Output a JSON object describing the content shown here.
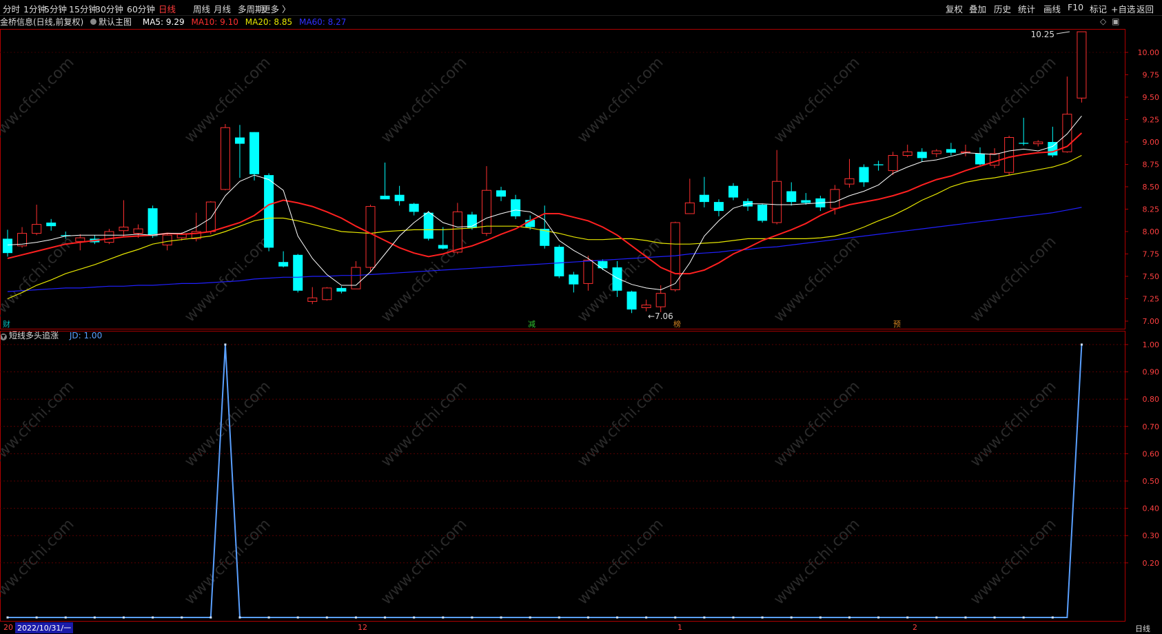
{
  "toolbar": {
    "left_tabs": [
      "分时",
      "1分钟",
      "5分钟",
      "15分钟",
      "30分钟",
      "60分钟",
      "日线",
      "周线",
      "月线",
      "多周期",
      "更多 〉"
    ],
    "active_tab": "日线",
    "right_tabs": [
      "复权",
      "叠加",
      "历史",
      "统计",
      "画线",
      "F10",
      "标记",
      "+自选",
      "返回"
    ]
  },
  "info": {
    "stock": "金桥信息(日线,前复权)",
    "main_chart": "默认主图",
    "ma5": "MA5: 9.29",
    "ma10": "MA10: 9.10",
    "ma20": "MA20: 8.85",
    "ma60": "MA60: 8.27"
  },
  "indicator_info": {
    "name": "短线多头追涨",
    "jd": "JD: 1.00"
  },
  "colors": {
    "up": "#ff3030",
    "down": "#00ffff",
    "ma5": "#ffffff",
    "ma10": "#ff2020",
    "ma20": "#e6e600",
    "ma60": "#2020ff",
    "indicator": "#5aa0ff",
    "axis": "#b00000"
  },
  "price_axis": [
    "10.00",
    "9.75",
    "9.50",
    "9.25",
    "9.00",
    "8.75",
    "8.50",
    "8.25",
    "8.00",
    "7.75",
    "7.50",
    "7.25",
    "7.00"
  ],
  "indicator_axis": [
    "1.00",
    "0.90",
    "0.80",
    "0.70",
    "0.60",
    "0.50",
    "0.40",
    "0.30",
    "0.20"
  ],
  "annotations": {
    "high": "10.25",
    "low": "←7.06",
    "markers": [
      "财",
      "减",
      "榜",
      "预"
    ]
  },
  "date_axis": {
    "cursor_date": "2022/10/31/一",
    "left_stub": "20",
    "months": [
      "12",
      "1",
      "2"
    ]
  },
  "bottom_right": "日线",
  "watermark": "www.cfchi.com",
  "chart_data": {
    "type": "candlestick",
    "ylim": [
      7.0,
      10.3
    ],
    "candles": [
      [
        7.92,
        7.76,
        8.02,
        7.72
      ],
      [
        7.84,
        7.98,
        8.05,
        7.82
      ],
      [
        7.98,
        8.08,
        8.3,
        7.96
      ],
      [
        8.1,
        8.06,
        8.14,
        8.01
      ],
      [
        7.96,
        7.95,
        8.0,
        7.92
      ],
      [
        7.89,
        7.93,
        7.97,
        7.79
      ],
      [
        7.92,
        7.88,
        7.96,
        7.86
      ],
      [
        7.88,
        8.0,
        8.03,
        7.86
      ],
      [
        8.01,
        8.05,
        8.35,
        7.94
      ],
      [
        7.98,
        8.03,
        8.08,
        7.93
      ],
      [
        8.26,
        7.95,
        8.29,
        7.93
      ],
      [
        7.85,
        7.96,
        7.98,
        7.79
      ],
      [
        7.93,
        7.97,
        7.99,
        7.9
      ],
      [
        7.92,
        8.0,
        8.21,
        7.89
      ],
      [
        8.0,
        8.33,
        8.34,
        7.97
      ],
      [
        8.47,
        9.16,
        9.2,
        8.46
      ],
      [
        9.05,
        8.98,
        9.19,
        8.6
      ],
      [
        9.11,
        8.64,
        9.11,
        8.57
      ],
      [
        8.63,
        7.82,
        8.65,
        7.78
      ],
      [
        7.66,
        7.61,
        7.78,
        7.6
      ],
      [
        7.74,
        7.34,
        7.75,
        7.32
      ],
      [
        7.22,
        7.26,
        7.38,
        7.19
      ],
      [
        7.24,
        7.37,
        7.38,
        7.23
      ],
      [
        7.37,
        7.33,
        7.39,
        7.31
      ],
      [
        7.36,
        7.6,
        7.67,
        7.36
      ],
      [
        7.6,
        8.28,
        8.3,
        7.55
      ],
      [
        8.4,
        8.36,
        8.77,
        8.36
      ],
      [
        8.41,
        8.34,
        8.51,
        8.29
      ],
      [
        8.31,
        8.22,
        8.32,
        8.18
      ],
      [
        8.21,
        7.92,
        8.23,
        7.9
      ],
      [
        7.85,
        7.81,
        8.05,
        7.8
      ],
      [
        7.77,
        8.22,
        8.32,
        7.75
      ],
      [
        8.19,
        8.04,
        8.22,
        8.02
      ],
      [
        7.98,
        8.46,
        8.73,
        7.95
      ],
      [
        8.46,
        8.39,
        8.5,
        8.34
      ],
      [
        8.36,
        8.17,
        8.41,
        8.14
      ],
      [
        8.13,
        8.05,
        8.18,
        8.02
      ],
      [
        8.03,
        7.84,
        8.29,
        7.81
      ],
      [
        7.83,
        7.5,
        7.85,
        7.48
      ],
      [
        7.52,
        7.41,
        7.55,
        7.32
      ],
      [
        7.42,
        7.68,
        7.73,
        7.34
      ],
      [
        7.67,
        7.59,
        7.69,
        7.57
      ],
      [
        7.6,
        7.34,
        7.67,
        7.27
      ],
      [
        7.33,
        7.13,
        7.34,
        7.09
      ],
      [
        7.15,
        7.18,
        7.24,
        7.11
      ],
      [
        7.16,
        7.31,
        7.4,
        7.1
      ],
      [
        7.35,
        8.1,
        8.11,
        7.33
      ],
      [
        8.2,
        8.32,
        8.59,
        8.2
      ],
      [
        8.41,
        8.33,
        8.61,
        8.27
      ],
      [
        8.33,
        8.23,
        8.36,
        8.17
      ],
      [
        8.51,
        8.38,
        8.54,
        8.35
      ],
      [
        8.34,
        8.28,
        8.37,
        8.23
      ],
      [
        8.3,
        8.12,
        8.31,
        8.1
      ],
      [
        8.1,
        8.56,
        8.91,
        8.08
      ],
      [
        8.45,
        8.33,
        8.55,
        8.29
      ],
      [
        8.35,
        8.32,
        8.43,
        8.3
      ],
      [
        8.37,
        8.27,
        8.4,
        8.23
      ],
      [
        8.26,
        8.47,
        8.52,
        8.19
      ],
      [
        8.53,
        8.59,
        8.81,
        8.49
      ],
      [
        8.72,
        8.55,
        8.75,
        8.5
      ],
      [
        8.75,
        8.74,
        8.79,
        8.68
      ],
      [
        8.68,
        8.85,
        8.89,
        8.63
      ],
      [
        8.85,
        8.89,
        8.97,
        8.83
      ],
      [
        8.89,
        8.82,
        8.93,
        8.78
      ],
      [
        8.87,
        8.9,
        8.92,
        8.83
      ],
      [
        8.92,
        8.88,
        8.99,
        8.85
      ],
      [
        8.88,
        8.89,
        8.97,
        8.84
      ],
      [
        8.87,
        8.75,
        8.94,
        8.74
      ],
      [
        8.74,
        8.87,
        8.93,
        8.71
      ],
      [
        8.66,
        9.05,
        9.07,
        8.63
      ],
      [
        8.99,
        8.98,
        9.27,
        8.96
      ],
      [
        8.98,
        9.0,
        9.02,
        8.95
      ],
      [
        9.0,
        8.85,
        9.17,
        8.83
      ],
      [
        8.89,
        9.31,
        9.73,
        8.88
      ],
      [
        9.49,
        10.23,
        10.23,
        9.44
      ]
    ],
    "ma5": [
      7.85,
      7.86,
      7.88,
      7.91,
      7.95,
      7.96,
      7.96,
      7.96,
      7.96,
      7.97,
      7.96,
      7.98,
      7.98,
      8.05,
      8.15,
      8.4,
      8.56,
      8.63,
      8.58,
      8.46,
      7.95,
      7.7,
      7.52,
      7.4,
      7.4,
      7.55,
      7.75,
      7.95,
      8.1,
      8.22,
      8.1,
      8.05,
      8.06,
      8.15,
      8.2,
      8.24,
      8.22,
      8.13,
      7.9,
      7.79,
      7.7,
      7.58,
      7.48,
      7.41,
      7.37,
      7.35,
      7.42,
      7.65,
      7.95,
      8.12,
      8.26,
      8.31,
      8.31,
      8.3,
      8.3,
      8.31,
      8.32,
      8.33,
      8.4,
      8.45,
      8.52,
      8.65,
      8.72,
      8.78,
      8.8,
      8.84,
      8.88,
      8.87,
      8.86,
      8.9,
      8.92,
      8.9,
      8.95,
      9.09,
      9.29
    ],
    "ma10": [
      7.7,
      7.74,
      7.78,
      7.82,
      7.86,
      7.88,
      7.9,
      7.92,
      7.94,
      7.95,
      7.96,
      7.98,
      7.97,
      7.98,
      8.0,
      8.05,
      8.1,
      8.18,
      8.3,
      8.35,
      8.32,
      8.28,
      8.22,
      8.15,
      8.06,
      7.98,
      7.9,
      7.82,
      7.76,
      7.72,
      7.75,
      7.8,
      7.84,
      7.9,
      7.97,
      8.03,
      8.12,
      8.2,
      8.2,
      8.16,
      8.12,
      8.05,
      7.96,
      7.84,
      7.72,
      7.6,
      7.53,
      7.53,
      7.57,
      7.65,
      7.75,
      7.82,
      7.9,
      7.96,
      8.02,
      8.09,
      8.18,
      8.25,
      8.3,
      8.33,
      8.36,
      8.4,
      8.45,
      8.52,
      8.58,
      8.62,
      8.68,
      8.73,
      8.78,
      8.83,
      8.86,
      8.88,
      8.89,
      8.95,
      9.1
    ],
    "ma20": [
      7.25,
      7.32,
      7.4,
      7.46,
      7.53,
      7.58,
      7.63,
      7.69,
      7.75,
      7.8,
      7.86,
      7.89,
      7.91,
      7.93,
      7.95,
      8.0,
      8.06,
      8.12,
      8.15,
      8.15,
      8.12,
      8.08,
      8.04,
      8.0,
      7.99,
      7.98,
      8.0,
      8.01,
      8.02,
      8.02,
      8.02,
      8.03,
      8.04,
      8.06,
      8.06,
      8.06,
      8.04,
      8.01,
      7.98,
      7.94,
      7.91,
      7.91,
      7.92,
      7.92,
      7.9,
      7.87,
      7.86,
      7.86,
      7.87,
      7.88,
      7.9,
      7.92,
      7.92,
      7.92,
      7.92,
      7.92,
      7.93,
      7.95,
      7.99,
      8.05,
      8.12,
      8.18,
      8.26,
      8.35,
      8.42,
      8.5,
      8.55,
      8.58,
      8.6,
      8.63,
      8.66,
      8.69,
      8.72,
      8.77,
      8.85
    ],
    "ma60": [
      7.33,
      7.34,
      7.35,
      7.36,
      7.37,
      7.37,
      7.38,
      7.39,
      7.39,
      7.4,
      7.4,
      7.41,
      7.42,
      7.42,
      7.43,
      7.44,
      7.45,
      7.47,
      7.48,
      7.49,
      7.49,
      7.5,
      7.5,
      7.51,
      7.51,
      7.52,
      7.53,
      7.54,
      7.55,
      7.56,
      7.57,
      7.58,
      7.59,
      7.6,
      7.61,
      7.62,
      7.63,
      7.64,
      7.65,
      7.66,
      7.67,
      7.68,
      7.69,
      7.7,
      7.71,
      7.72,
      7.73,
      7.75,
      7.76,
      7.77,
      7.79,
      7.8,
      7.82,
      7.83,
      7.85,
      7.87,
      7.89,
      7.91,
      7.93,
      7.95,
      7.97,
      7.99,
      8.01,
      8.03,
      8.05,
      8.07,
      8.09,
      8.11,
      8.13,
      8.15,
      8.17,
      8.19,
      8.21,
      8.24,
      8.27
    ],
    "indicator": {
      "name": "短线多头追涨",
      "ylim": [
        0,
        1
      ],
      "values": [
        0,
        0,
        0,
        0,
        0,
        0,
        0,
        0,
        0,
        0,
        0,
        0,
        0,
        0,
        0,
        1,
        0,
        0,
        0,
        0,
        0,
        0,
        0,
        0,
        0,
        0,
        0,
        0,
        0,
        0,
        0,
        0,
        0,
        0,
        0,
        0,
        0,
        0,
        0,
        0,
        0,
        0,
        0,
        0,
        0,
        0,
        0,
        0,
        0,
        0,
        0,
        0,
        0,
        0,
        0,
        0,
        0,
        0,
        0,
        0,
        0,
        0,
        0,
        0,
        0,
        0,
        0,
        0,
        0,
        0,
        0,
        0,
        0,
        0,
        1
      ]
    }
  }
}
